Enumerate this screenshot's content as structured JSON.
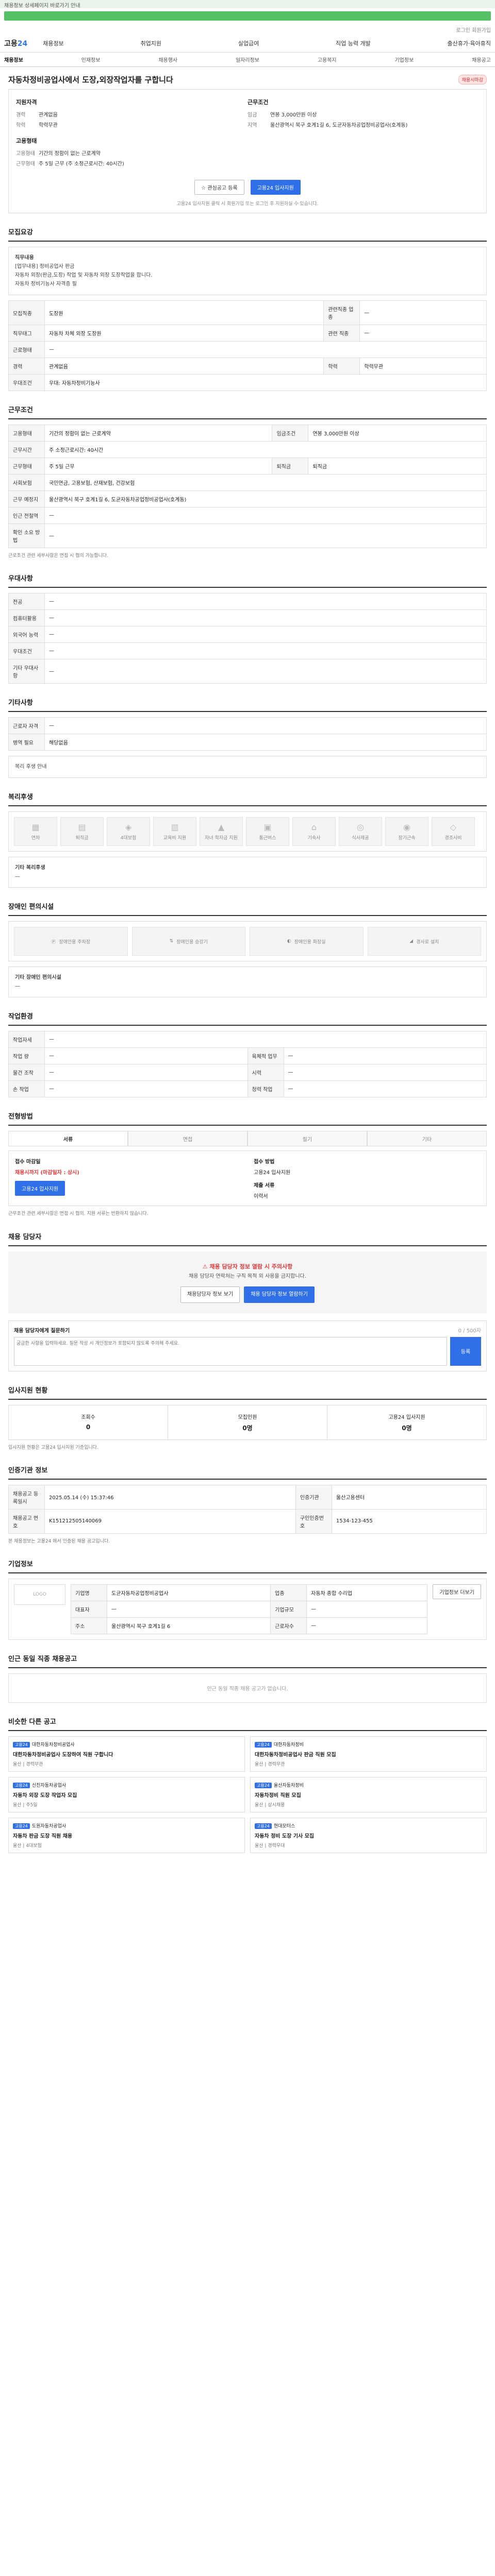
{
  "notice": "채용정보 상세페이지 바로가기 안내",
  "topline": "로그인 회원가입",
  "gnb": {
    "logo_a": "고용",
    "logo_b": "24",
    "menu": [
      "채용정보",
      "취업지원",
      "실업급여",
      "직업 능력 개발",
      "출산휴가·육아휴직"
    ]
  },
  "lnb": [
    "채용정보",
    "인재정보",
    "채용행사",
    "일자리정보",
    "고용복지",
    "기업정보",
    "채용공고"
  ],
  "title": "자동차정비공업사에서 도장,외장작업자를 구합니다",
  "badge": "채용시마감",
  "summary": {
    "left_head": "지원자격",
    "left": [
      {
        "k": "경력",
        "v": "관계없음"
      },
      {
        "k": "학력",
        "v": "학력무관"
      }
    ],
    "cond_head": "고용형태",
    "cond": [
      {
        "k": "고용형태",
        "v": "기간의 정함이 없는 근로계약"
      },
      {
        "k": "근무형태",
        "v": "주 5일 근무 (주 소정근로시간: 40시간)"
      }
    ],
    "right_head": "근무조건",
    "right": [
      {
        "k": "임금",
        "v": "연봉 3,000만원 이상"
      },
      {
        "k": "지역",
        "v": "울산광역시 북구 호계1길 6, 도균자동차공업정비공업사(호계동)"
      }
    ],
    "btn_scrap": "관심공고 등록",
    "btn_apply": "고용24 입사지원",
    "note": "고용24 입사지원 클릭 시 회원가입 또는 로그인 후 지원하실 수 있습니다."
  },
  "recruit": {
    "h": "모집요강",
    "desc_label": "직무내용",
    "desc": [
      "[업무내용] 정비공업사 판금",
      "자동차 외장(판금,도장) 작업 및 자동차 외장 도장작업을 합니다.",
      "자동차 정비기능사 자격증 필"
    ],
    "rows": [
      [
        "모집직종",
        "도장원",
        "관련직종 업종",
        "—"
      ],
      [
        "직무태그",
        "자동차 차체 외장 도장원",
        "관련 직종",
        "—"
      ],
      [
        "근로형태",
        "—",
        "",
        ""
      ],
      [
        "경력",
        "관계없음",
        "학력",
        "학력무관"
      ],
      [
        "우대조건",
        "우대: 자동차정비기능사",
        "",
        ""
      ]
    ]
  },
  "work": {
    "h": "근무조건",
    "rows": [
      [
        "고용형태",
        "기간의 정함이 없는 근로계약",
        "임금조건",
        "연봉 3,000만원 이상"
      ],
      [
        "근무시간",
        "주 소정근로시간: 40시간",
        "",
        ""
      ],
      [
        "근무형태",
        "주 5일 근무",
        "퇴직금",
        "퇴직금"
      ],
      [
        "사회보험",
        "국민연금, 고용보험, 산재보험, 건강보험",
        "",
        ""
      ],
      [
        "근무 예정지",
        "울산광역시 북구 호계1길 6, 도균자동차공업정비공업사(호계동)",
        "",
        ""
      ]
    ],
    "extra": [
      "인근 전철역",
      "—",
      "확인 소요 방법",
      "—"
    ],
    "note": "근로조건 관련 세부사항은 면접 시 협의 가능합니다."
  },
  "pref": {
    "h": "우대사항",
    "rows": [
      [
        "전공",
        "—"
      ],
      [
        "컴퓨터활용",
        "—"
      ],
      [
        "외국어 능력",
        "—"
      ],
      [
        "우대조건",
        "—"
      ],
      [
        "기타 우대사항",
        "—"
      ]
    ]
  },
  "etc": {
    "h": "기타사항",
    "rows": [
      [
        "근로자 자격",
        "—"
      ],
      [
        "병역 필요",
        "해당없음"
      ]
    ],
    "note": "복리 후생 안내"
  },
  "welfare": {
    "h": "복리후생",
    "tiles": [
      "연차",
      "퇴직금",
      "4대보험",
      "교육비 지원",
      "자녀 학자금 지원",
      "통근버스",
      "기숙사",
      "식사제공",
      "장기근속",
      "경조사비"
    ],
    "sub": "기타 복리후생",
    "subv": "—"
  },
  "disab": {
    "h": "장애인 편의시설",
    "tiles": [
      "장애인용 주차장",
      "장애인용 승강기",
      "장애인용 화장실",
      "경사로 설치"
    ],
    "sub": "기타 장애인 편의시설",
    "subv": "—"
  },
  "place": {
    "h": "작업환경",
    "rows": [
      [
        "작업자세",
        "—",
        "",
        ""
      ],
      [
        "작업 량",
        "—",
        "육체적 업무",
        "—"
      ],
      [
        "물건 조작",
        "—",
        "시력",
        "—"
      ],
      [
        "손 작업",
        "—",
        "청력 작업",
        "—"
      ]
    ]
  },
  "proc": {
    "h": "전형방법",
    "steps": [
      "서류",
      "면접",
      "필기",
      "기타"
    ],
    "a_label": "접수 마감일",
    "a_val": "채용시까지 (마감일자 : 상시)",
    "b_label": "접수 방법",
    "b_val": "고용24 입사지원",
    "apply_btn": "고용24 입사지원",
    "c_label": "제출 서류",
    "c_val": "이력서",
    "note": "근무조건 관련 세부사항은 면접 시 협의. 지원 서류는 반환하지 않습니다."
  },
  "contact": {
    "h": "채용 담당자",
    "warn": "채용 담당자 정보 열람 시 주의사항",
    "body": "채용 담당자 연락처는 구직 목적 외 사용을 금지합니다.",
    "btn1": "채용담당자 정보 보기",
    "btn2": "채용 담당자 정보 열람하기",
    "q_head": "채용 담당자에게 질문하기",
    "q_sub": "0 / 500자",
    "q_ph": "궁금한 사항을 입력하세요. 질문 작성 시 개인정보가 포함되지 않도록 주의해 주세요.",
    "q_send": "등록"
  },
  "stats": {
    "h": "입사지원 현황",
    "items": [
      {
        "k": "조회수",
        "v": "0"
      },
      {
        "k": "모집인원",
        "v": "0명"
      },
      {
        "k": "고용24 입사지원",
        "v": "0명"
      }
    ],
    "note": "입사지원 현황은 고용24 입사지원 기준입니다."
  },
  "info": {
    "h": "인증기관 정보",
    "rows": [
      [
        "채용공고 등록일시",
        "2025.05.14 (수) 15:37:46",
        "인증기관",
        "울산고용센터"
      ],
      [
        "채용공고 번호",
        "K151212505140069",
        "구인인증번호",
        "1534-123-455"
      ]
    ],
    "note": "본 채용정보는 고용24 에서 인증된 채용 공고입니다."
  },
  "company": {
    "h": "기업정보",
    "logo": "LOGO",
    "rows": [
      [
        "기업명",
        "도균자동차공업정비공업사",
        "업종",
        "자동차 종합 수리업"
      ],
      [
        "대표자",
        "—",
        "기업규모",
        "—"
      ],
      [
        "주소",
        "울산광역시 북구 호계1길 6",
        "근로자수",
        "—"
      ]
    ],
    "btn": "기업정보 더보기"
  },
  "closed": {
    "h": "인근 동일 직종 채용공고",
    "empty": "인근 동일 직종 채용 공고가 없습니다."
  },
  "similar": {
    "h": "비슷한 다른 공고",
    "cards": [
      {
        "tag": "고용24",
        "co": "대한자동차정비공업사",
        "ttl": "대한자동차정비공업사 도장하여 직원 구합니다",
        "meta": "울산 | 경력무관"
      },
      {
        "tag": "고용24",
        "co": "대한자동차정비",
        "ttl": "대한자동차정비공업사 판금 직원 모집",
        "meta": "울산 | 경력무관"
      },
      {
        "tag": "고용24",
        "co": "신진자동차공업사",
        "ttl": "자동차 외장 도장 작업자 모집",
        "meta": "울산 | 주5일"
      },
      {
        "tag": "고용24",
        "co": "울산자동차정비",
        "ttl": "자동차정비 직원 모집",
        "meta": "울산 | 상시채용"
      },
      {
        "tag": "고용24",
        "co": "도원자동차공업사",
        "ttl": "자동차 판금 도장 직원 채용",
        "meta": "울산 | 4대보험"
      },
      {
        "tag": "고용24",
        "co": "현대모터스",
        "ttl": "자동차 정비 도장 기사 모집",
        "meta": "울산 | 경력우대"
      }
    ]
  }
}
